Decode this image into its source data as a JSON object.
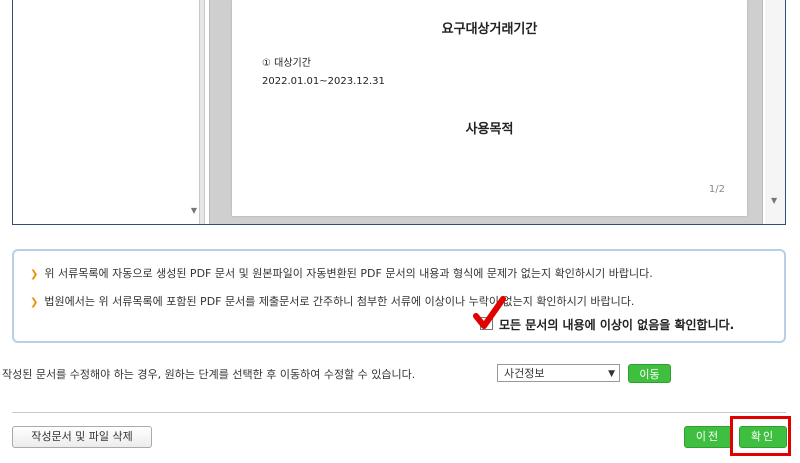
{
  "viewer": {
    "heading_period": "요구대상거래기간",
    "item_label": "① 대상기간",
    "period_value": "2022.01.01~2023.12.31",
    "heading_purpose": "사용목적",
    "page_indicator": "1/2"
  },
  "confirmation": {
    "notice_1": "위 서류목록에 자동으로 생성된 PDF 문서 및 원본파일이 자동변환된 PDF 문서의 내용과 형식에 문제가 없는지 확인하시기 바랍니다.",
    "notice_2": "법원에서는 위 서류목록에 포함된 PDF 문서를 제출문서로 간주하니 첨부한 서류에 이상이나 누락이 없는지 확인하시기 바랍니다.",
    "checkbox_label": "모든 문서의 내용에 이상이 없음을 확인합니다.",
    "checked": true
  },
  "edit": {
    "instruction": "작성된 문서를 수정해야 하는 경우, 원하는 단계를 선택한 후 이동하여 수정할 수 있습니다.",
    "step_selected": "사건정보",
    "move_label": "이동"
  },
  "footer": {
    "delete_label": "작성문서 및 파일 삭제",
    "prev_label": "이전",
    "ok_label": "확인"
  },
  "colors": {
    "accent_green": "#3fbf3f",
    "highlight_red": "#e00000",
    "bullet_orange": "#f08c00"
  }
}
